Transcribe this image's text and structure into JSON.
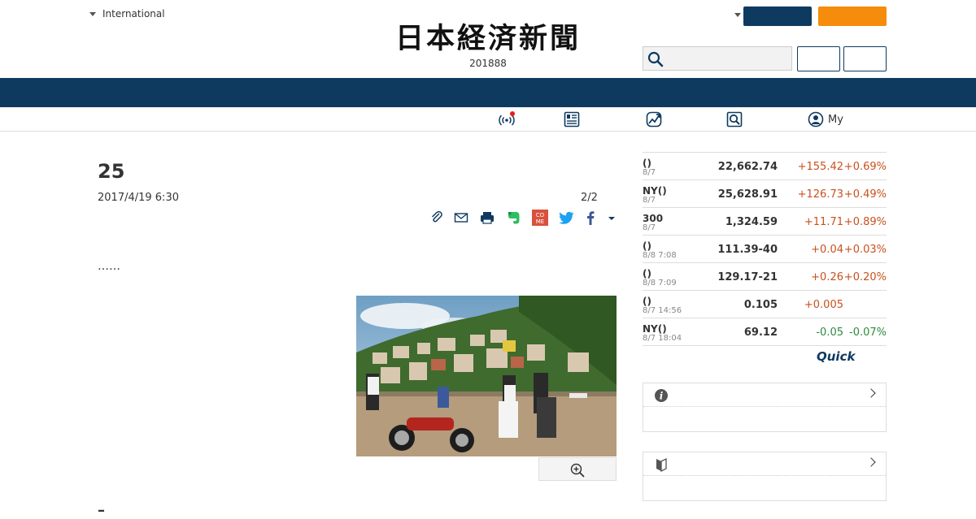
{
  "header": {
    "language_label": "International",
    "logo_text": "日本経済新聞",
    "logo_subtext": "201888",
    "colors": {
      "navy": "#0f3a60",
      "orange": "#f58c0c"
    }
  },
  "subnav": {
    "items": [
      {
        "icon": "broadcast-icon",
        "label": ""
      },
      {
        "icon": "newspaper-icon",
        "label": ""
      },
      {
        "icon": "chart-icon",
        "label": ""
      },
      {
        "icon": "search-icon",
        "label": ""
      },
      {
        "icon": "user-icon",
        "label": "My"
      }
    ]
  },
  "article": {
    "title": "25",
    "date": "2017/4/19 6:30",
    "page": "2/2",
    "body": "……",
    "bottom_mark": "–",
    "share_icons": [
      "clip-icon",
      "mail-icon",
      "print-icon",
      "evernote-icon",
      "come-icon",
      "twitter-icon",
      "facebook-icon",
      "dropdown-icon"
    ],
    "come_label": "CO ME",
    "image_icon": "zoom-in-icon"
  },
  "market": {
    "rows": [
      {
        "name": "()",
        "time": "8/7",
        "value": "22,662.74",
        "change": "+155.42",
        "pct": "+0.69%",
        "dir": "up"
      },
      {
        "name": "NY()",
        "time": "8/7",
        "value": "25,628.91",
        "change": "+126.73",
        "pct": "+0.49%",
        "dir": "up"
      },
      {
        "name": "300",
        "time": "8/7",
        "value": "1,324.59",
        "change": "+11.71",
        "pct": "+0.89%",
        "dir": "up"
      },
      {
        "name": "()",
        "time": "8/8 7:08",
        "value": "111.39-40",
        "change": "+0.04",
        "pct": "+0.03%",
        "dir": "up"
      },
      {
        "name": "()",
        "time": "8/8 7:09",
        "value": "129.17-21",
        "change": "+0.26",
        "pct": "+0.20%",
        "dir": "up"
      },
      {
        "name": "()",
        "time": "8/7 14:56",
        "value": "0.105",
        "change": "+0.005",
        "pct": "",
        "dir": "up"
      },
      {
        "name": "NY()",
        "time": "8/7 18:04",
        "value": "69.12",
        "change": "-0.05",
        "pct": "-0.07%",
        "dir": "down"
      }
    ],
    "provider": "Quick"
  },
  "panels": [
    {
      "icon": "info-icon"
    },
    {
      "icon": "beginner-icon"
    }
  ]
}
